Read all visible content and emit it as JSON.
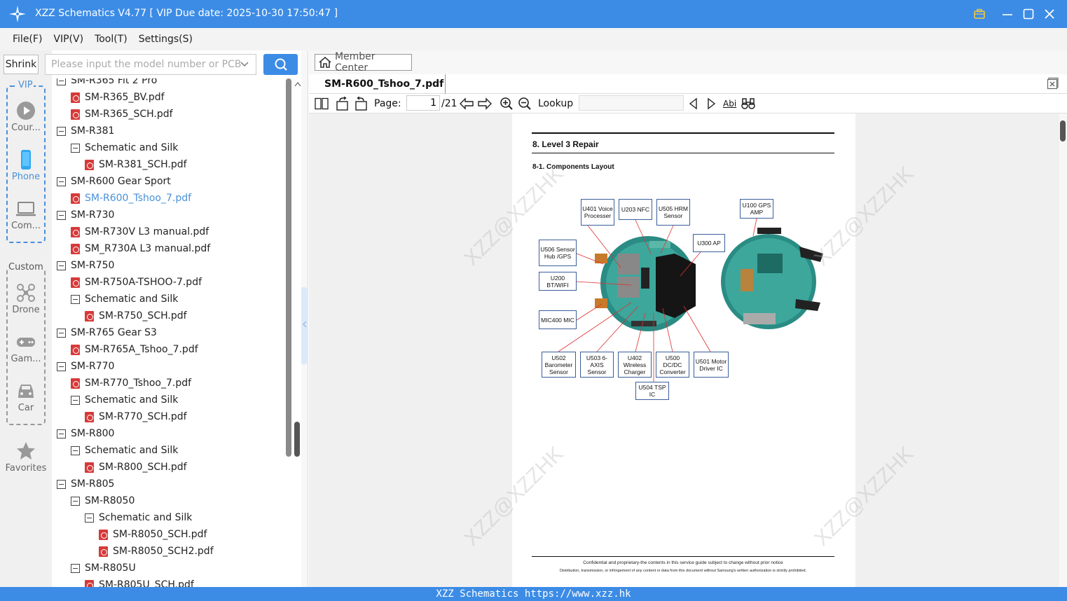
{
  "titlebar": {
    "title": "XZZ Schematics V4.77 [ VIP Due date: 2025-10-30 17:50:47 ]"
  },
  "menu": {
    "items": [
      "File(F)",
      "VIP(V)",
      "Tool(T)",
      "Settings(S)"
    ]
  },
  "sidebar": {
    "shrink_label": "Shrink",
    "vip_label": "VIP",
    "custom_label": "Custom",
    "vip_items": [
      {
        "label": "Cour...",
        "icon": "play-icon"
      },
      {
        "label": "Phone",
        "icon": "phone-icon"
      },
      {
        "label": "Com...",
        "icon": "laptop-icon"
      }
    ],
    "custom_items": [
      {
        "label": "Drone",
        "icon": "drone-icon"
      },
      {
        "label": "Gam...",
        "icon": "gamepad-icon"
      },
      {
        "label": "Car",
        "icon": "car-icon"
      }
    ],
    "favorites_label": "Favorites"
  },
  "search": {
    "placeholder": "Please input the model number or PCB"
  },
  "tree": {
    "items": [
      {
        "text": "SM-R365 Fit 2 Pro",
        "type": "folder",
        "level": 0
      },
      {
        "text": "SM-R365_BV.pdf",
        "type": "pdf",
        "level": 1
      },
      {
        "text": "SM-R365_SCH.pdf",
        "type": "pdf",
        "level": 1
      },
      {
        "text": "SM-R381",
        "type": "folder",
        "level": 0
      },
      {
        "text": "Schematic and Silk",
        "type": "folder",
        "level": 1
      },
      {
        "text": "SM-R381_SCH.pdf",
        "type": "pdf",
        "level": 2
      },
      {
        "text": "SM-R600 Gear Sport",
        "type": "folder",
        "level": 0
      },
      {
        "text": "SM-R600_Tshoo_7.pdf",
        "type": "pdf",
        "level": 1,
        "selected": true
      },
      {
        "text": "SM-R730",
        "type": "folder",
        "level": 0
      },
      {
        "text": "SM-R730V L3 manual.pdf",
        "type": "pdf",
        "level": 1
      },
      {
        "text": "SM_R730A L3 manual.pdf",
        "type": "pdf",
        "level": 1
      },
      {
        "text": "SM-R750",
        "type": "folder",
        "level": 0
      },
      {
        "text": "SM-R750A-TSHOO-7.pdf",
        "type": "pdf",
        "level": 1
      },
      {
        "text": "Schematic and Silk",
        "type": "folder",
        "level": 1
      },
      {
        "text": "SM-R750_SCH.pdf",
        "type": "pdf",
        "level": 2
      },
      {
        "text": "SM-R765 Gear S3",
        "type": "folder",
        "level": 0
      },
      {
        "text": "SM-R765A_Tshoo_7.pdf",
        "type": "pdf",
        "level": 1
      },
      {
        "text": "SM-R770",
        "type": "folder",
        "level": 0
      },
      {
        "text": "SM-R770_Tshoo_7.pdf",
        "type": "pdf",
        "level": 1
      },
      {
        "text": "Schematic and Silk",
        "type": "folder",
        "level": 1
      },
      {
        "text": "SM-R770_SCH.pdf",
        "type": "pdf",
        "level": 2
      },
      {
        "text": "SM-R800",
        "type": "folder",
        "level": 0
      },
      {
        "text": "Schematic and Silk",
        "type": "folder",
        "level": 1
      },
      {
        "text": "SM-R800_SCH.pdf",
        "type": "pdf",
        "level": 2
      },
      {
        "text": "SM-R805",
        "type": "folder",
        "level": 0
      },
      {
        "text": "SM-R8050",
        "type": "folder",
        "level": 1
      },
      {
        "text": "Schematic and Silk",
        "type": "folder",
        "level": 2
      },
      {
        "text": "SM-R8050_SCH.pdf",
        "type": "pdf",
        "level": 3
      },
      {
        "text": "SM-R8050_SCH2.pdf",
        "type": "pdf",
        "level": 3
      },
      {
        "text": "SM-R805U",
        "type": "folder",
        "level": 1
      },
      {
        "text": "SM-R805U_SCH.pdf",
        "type": "pdf",
        "level": 2
      }
    ]
  },
  "viewer": {
    "member_center": "Member Center",
    "tab_title": "SM-R600_Tshoo_7.pdf",
    "page_label": "Page:",
    "page_current": "1",
    "page_total": "/21",
    "lookup_label": "Lookup",
    "abi_label": "Abi"
  },
  "document": {
    "heading": "8. Level 3 Repair",
    "subheading": "8-1. Components Layout",
    "watermark": "XZZ@XZZHK",
    "labels": {
      "u401": "U401 Voice Processer",
      "u203": "U203 NFC",
      "u505": "U505 HRM Sensor",
      "u100": "U100 GPS AMP",
      "u300": "U300 AP",
      "u506": "U506 Sensor Hub /GPS",
      "u200": "U200 BT/WIFI",
      "mic400": "MIC400 MIC",
      "u502": "U502 Barometer Sensor",
      "u503": "U503 6-AXIS Sensor",
      "u402": "U402 Wireless Charger",
      "u500": "U500 DC/DC Converter",
      "u501": "U501 Motor Driver IC",
      "u504": "U504 TSP IC"
    },
    "footer1": "Confidential and proprietary-the contents in this service guide subject to change without prior notice",
    "footer2": "Distribution, transmission, or infringement of any content or data from this document without Samsung's written authorization is strictly prohibited."
  },
  "statusbar": {
    "text": "XZZ Schematics https://www.xzz.hk"
  },
  "colors": {
    "accent": "#3c8ce6",
    "selected": "#4a90d9",
    "pdf": "#d63a3a"
  }
}
